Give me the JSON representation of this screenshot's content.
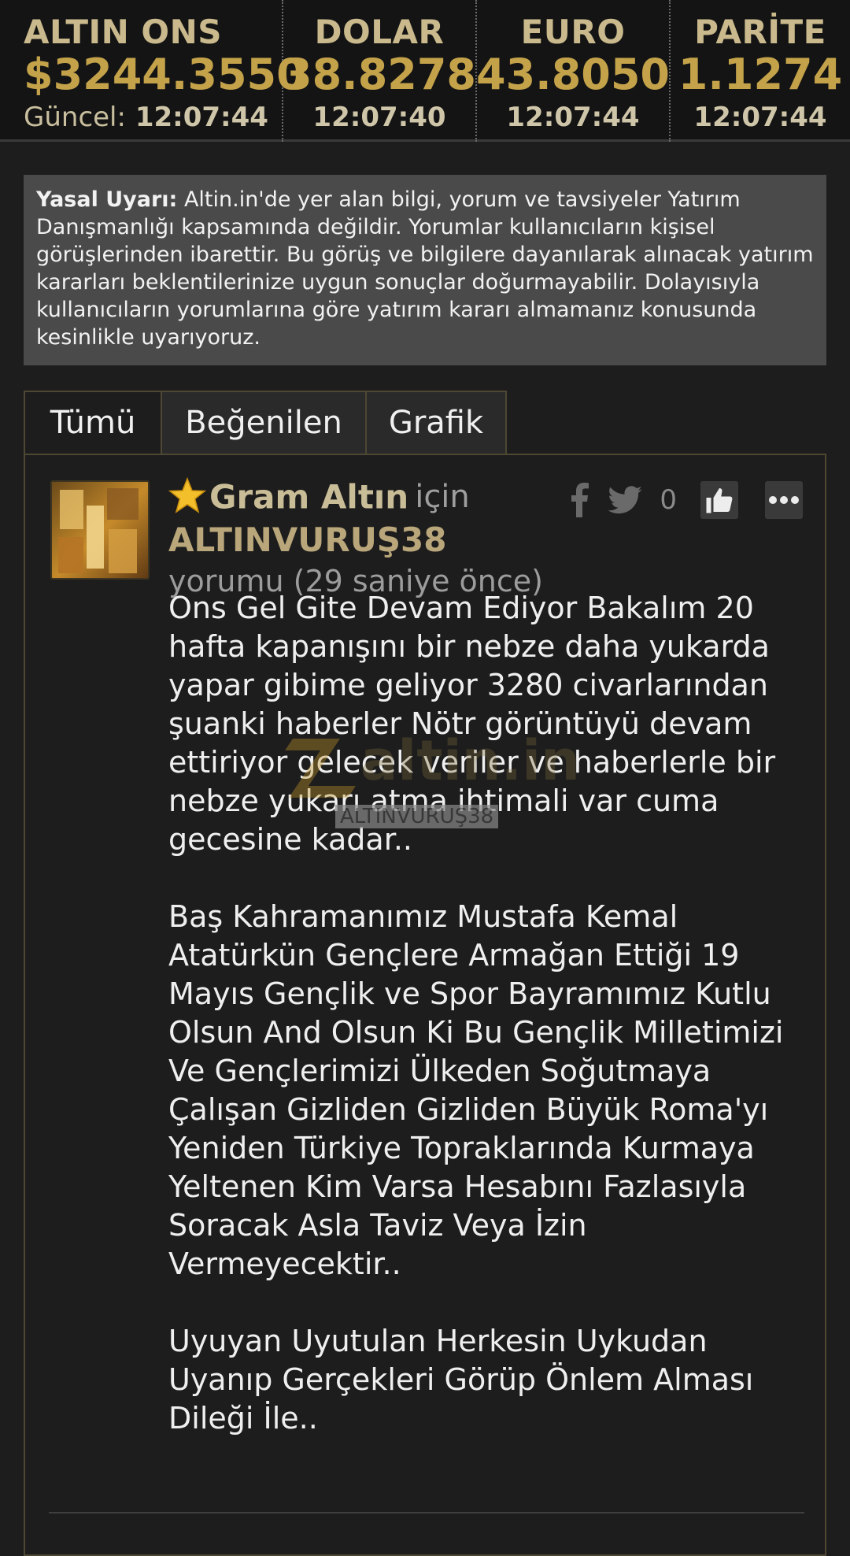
{
  "ticker": [
    {
      "name": "ALTIN ONS",
      "value": "$3244.3550",
      "time_label": "Güncel:",
      "time": "12:07:44"
    },
    {
      "name": "DOLAR",
      "value": "38.8278",
      "time": "12:07:40"
    },
    {
      "name": "EURO",
      "value": "43.8050",
      "time": "12:07:44"
    },
    {
      "name": "PARİTE",
      "value": "1.1274",
      "time": "12:07:44"
    }
  ],
  "disclaimer": {
    "title": "Yasal Uyarı:",
    "text": " Altin.in'de yer alan bilgi, yorum ve tavsiyeler Yatırım Danışmanlığı kapsamında değildir. Yorumlar kullanıcıların kişisel görüşlerinden ibarettir. Bu görüş ve bilgilere dayanılarak alınacak yatırım kararları beklentilerinize uygun sonuçlar doğurmayabilir. Dolayısıyla kullanıcıların yorumlarına göre yatırım kararı almamanız konusunda kesinlikle uyarıyoruz."
  },
  "tabs": [
    {
      "label": "Tümü"
    },
    {
      "label": "Beğenilen"
    },
    {
      "label": "Grafik"
    }
  ],
  "comment": {
    "item_name": "Gram Altın",
    "for_word": "için",
    "user": "ALTINVURUŞ38",
    "meta": "yorumu (29 saniye önce)",
    "like_count": "0",
    "paragraphs": [
      "Ons Gel Gite Devam Ediyor Bakalım 20 hafta kapanışını bir nebze daha yukarda yapar gibime geliyor 3280 civarlarından şuanki haberler Nötr görüntüyü devam ettiriyor gelecek veriler ve haberlerle bir nebze yukarı atma ihtimali var cuma gecesine kadar..",
      "Baş Kahramanımız Mustafa Kemal Atatürkün Gençlere Armağan Ettiği 19 Mayıs Gençlik ve Spor Bayramımız Kutlu Olsun And Olsun Ki Bu Gençlik Milletimizi Ve Gençlerimizi Ülkeden Soğutmaya Çalışan Gizliden Gizliden Büyük Roma'yı Yeniden Türkiye Topraklarında Kurmaya Yeltenen Kim Varsa Hesabını Fazlasıyla Soracak Asla Taviz Veya İzin Vermeyecektir..",
      "Uyuyan Uyutulan Herkesin Uykudan Uyanıp Gerçekleri Görüp Önlem Alması Dileği İle.."
    ],
    "watermark_brand": "altin.in",
    "watermark_user": "ALTINVURUŞ38"
  },
  "colors": {
    "background": "#1d1d1d",
    "gold": "#c3a24a",
    "panel_border": "#4d4733",
    "disclaimer_bg": "#4a4a4a"
  },
  "icons": [
    "star-icon",
    "facebook-icon",
    "twitter-icon",
    "thumbs-up-icon",
    "more-dots-icon"
  ]
}
